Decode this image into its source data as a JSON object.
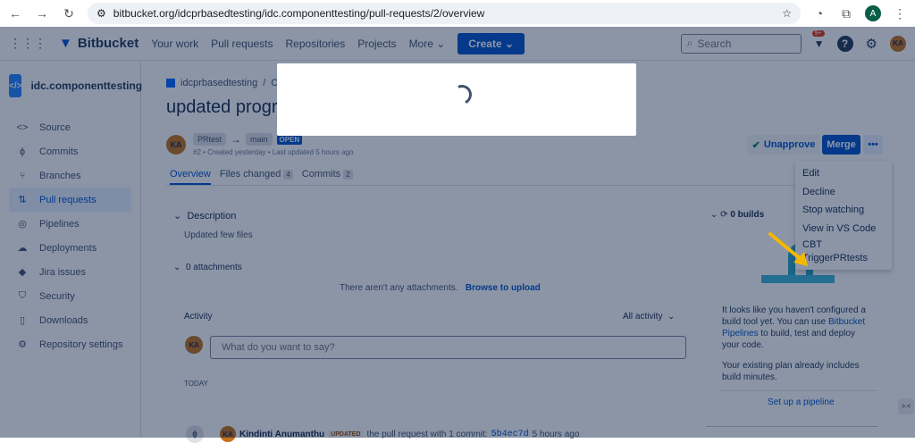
{
  "browser": {
    "url": "bitbucket.org/idcprbasedtesting/idc.componenttesting/pull-requests/2/overview",
    "profile": "A"
  },
  "topnav": {
    "brand": "Bitbucket",
    "items": [
      "Your work",
      "Pull requests",
      "Repositories",
      "Projects",
      "More"
    ],
    "create": "Create",
    "search_placeholder": "Search",
    "notif_badge": "9+",
    "avatar": "KA"
  },
  "sidebar": {
    "repo": "idc.componenttesting",
    "items": [
      {
        "label": "Source",
        "icon": "code"
      },
      {
        "label": "Commits",
        "icon": "commit"
      },
      {
        "label": "Branches",
        "icon": "branch"
      },
      {
        "label": "Pull requests",
        "icon": "pull-request"
      },
      {
        "label": "Pipelines",
        "icon": "pipeline"
      },
      {
        "label": "Deployments",
        "icon": "cloud"
      },
      {
        "label": "Jira issues",
        "icon": "jira"
      },
      {
        "label": "Security",
        "icon": "shield"
      },
      {
        "label": "Downloads",
        "icon": "file"
      },
      {
        "label": "Repository settings",
        "icon": "gear"
      }
    ]
  },
  "pr": {
    "breadcrumb": [
      "idcprbasedtesting",
      "Com"
    ],
    "title": "updated program",
    "source": "PRtest",
    "target": "main",
    "status": "OPEN",
    "subtitle": "#2 • Created yesterday • Last updated 5 hours ago",
    "avatar": "KA",
    "tabs": [
      {
        "label": "Overview"
      },
      {
        "label": "Files changed",
        "count": "4"
      },
      {
        "label": "Commits",
        "count": "2"
      }
    ],
    "description_label": "Description",
    "description": "Updated few files",
    "attachments_label": "0 attachments",
    "no_attachments": "There aren't any attachments.",
    "browse": "Browse to upload",
    "activity_label": "Activity",
    "activity_filter": "All activity",
    "comment_placeholder": "What do you want to say?",
    "today": "TODAY",
    "event": {
      "user": "Kindinti Anumanthu",
      "badge": "UPDATED",
      "text": "the pull request with 1 commit:",
      "commit": "5b4ec7d",
      "time": "5 hours ago"
    }
  },
  "actions": {
    "unapprove": "Unapprove",
    "merge": "Merge",
    "more": "•••"
  },
  "menu": [
    "Edit",
    "Decline",
    "Stop watching",
    "View in VS Code",
    "CBT",
    "TriggerPRtests"
  ],
  "builds": {
    "label": "0 builds",
    "p1a": "It looks like you haven't configured a build tool yet. You can use ",
    "p1link": "Bitbucket Pipelines",
    "p1b": " to build, test and deploy your code.",
    "p2": "Your existing plan already includes build minutes.",
    "setup": "Set up a pipeline"
  },
  "colors": {
    "accent": "#0052cc",
    "overlay": "rgba(9,30,66,0.47)",
    "arrow": "#f5b800"
  }
}
